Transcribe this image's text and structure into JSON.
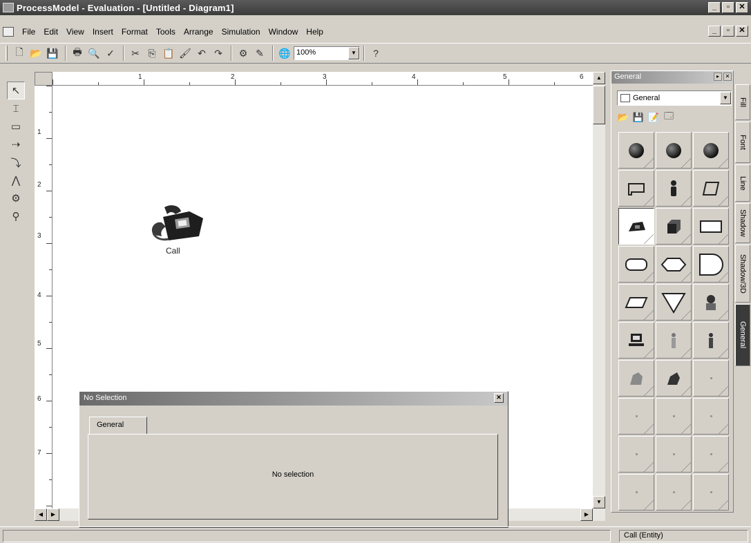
{
  "window": {
    "title": "ProcessModel - Evaluation - [Untitled - Diagram1]",
    "controls": [
      "_",
      "▫",
      "✕"
    ]
  },
  "menu": [
    "File",
    "Edit",
    "View",
    "Insert",
    "Format",
    "Tools",
    "Arrange",
    "Simulation",
    "Window",
    "Help"
  ],
  "toolbar": {
    "zoom": "100%",
    "help": "?"
  },
  "ruler": {
    "h": [
      "1",
      "2",
      "3",
      "4",
      "5",
      "6"
    ],
    "v": [
      "1",
      "2",
      "3",
      "4",
      "5",
      "6",
      "7"
    ]
  },
  "canvas": {
    "entity_label": "Call"
  },
  "dialog": {
    "title": "No Selection",
    "tab": "General",
    "message": "No selection"
  },
  "palette": {
    "title": "General",
    "selected": "General",
    "side_tabs": [
      "Fill",
      "Font",
      "Line",
      "Shadow",
      "Shadow/3D",
      "General"
    ]
  },
  "status": {
    "right": "Call (Entity)"
  }
}
